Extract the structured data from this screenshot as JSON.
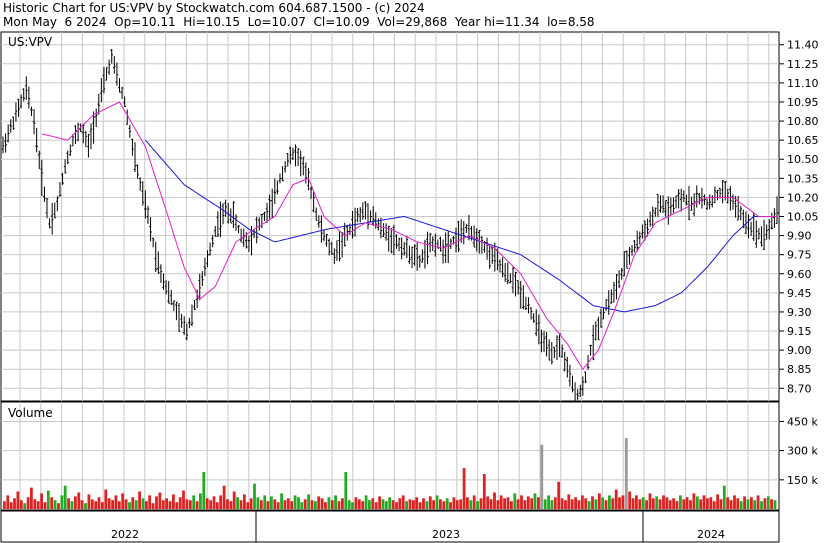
{
  "header": {
    "line1": "Historic Chart for US:VPV by Stockwatch.com 604.687.1500 - (c) 2024",
    "line2": "Mon May  6 2024  Op=10.11  Hi=10.15  Lo=10.07  Cl=10.09  Vol=29,868  Year hi=11.34  lo=8.58"
  },
  "chart_data": [
    {
      "type": "candlestick",
      "title": "US:VPV",
      "ylim": [
        8.6,
        11.5
      ],
      "yticks": [
        "11.40",
        "11.25",
        "11.10",
        "10.95",
        "10.80",
        "10.65",
        "10.50",
        "10.35",
        "10.20",
        "10.05",
        "9.90",
        "9.75",
        "9.60",
        "9.45",
        "9.30",
        "9.15",
        "9.00",
        "8.85",
        "8.70"
      ],
      "grid": true,
      "series": [
        {
          "key": "price",
          "points": [
            [
              0,
              10.6
            ],
            [
              5,
              10.85
            ],
            [
              9,
              11.05
            ],
            [
              12,
              10.8
            ],
            [
              15,
              10.35
            ],
            [
              18,
              10.0
            ],
            [
              21,
              10.15
            ],
            [
              24,
              10.45
            ],
            [
              27,
              10.65
            ],
            [
              30,
              10.75
            ],
            [
              33,
              10.6
            ],
            [
              36,
              10.85
            ],
            [
              39,
              11.1
            ],
            [
              42,
              11.3
            ],
            [
              44,
              11.15
            ],
            [
              47,
              10.95
            ],
            [
              50,
              10.6
            ],
            [
              53,
              10.3
            ],
            [
              56,
              10.05
            ],
            [
              59,
              9.75
            ],
            [
              62,
              9.55
            ],
            [
              65,
              9.4
            ],
            [
              68,
              9.25
            ],
            [
              71,
              9.15
            ],
            [
              74,
              9.35
            ],
            [
              77,
              9.55
            ],
            [
              80,
              9.8
            ],
            [
              83,
              10.0
            ],
            [
              86,
              10.1
            ],
            [
              89,
              10.05
            ],
            [
              92,
              9.9
            ],
            [
              95,
              9.85
            ],
            [
              98,
              9.95
            ],
            [
              101,
              10.05
            ],
            [
              104,
              10.15
            ],
            [
              107,
              10.35
            ],
            [
              110,
              10.5
            ],
            [
              113,
              10.55
            ],
            [
              116,
              10.45
            ],
            [
              119,
              10.25
            ],
            [
              122,
              10.0
            ],
            [
              125,
              9.85
            ],
            [
              128,
              9.75
            ],
            [
              131,
              9.85
            ],
            [
              134,
              9.95
            ],
            [
              137,
              10.05
            ],
            [
              140,
              10.1
            ],
            [
              143,
              10.05
            ],
            [
              146,
              9.95
            ],
            [
              149,
              9.9
            ],
            [
              152,
              9.85
            ],
            [
              155,
              9.8
            ],
            [
              158,
              9.75
            ],
            [
              161,
              9.7
            ],
            [
              164,
              9.8
            ],
            [
              167,
              9.85
            ],
            [
              170,
              9.8
            ],
            [
              173,
              9.85
            ],
            [
              176,
              9.9
            ],
            [
              179,
              9.95
            ],
            [
              182,
              9.9
            ],
            [
              185,
              9.85
            ],
            [
              188,
              9.75
            ],
            [
              191,
              9.7
            ],
            [
              194,
              9.6
            ],
            [
              197,
              9.55
            ],
            [
              200,
              9.45
            ],
            [
              203,
              9.35
            ],
            [
              206,
              9.2
            ],
            [
              209,
              9.05
            ],
            [
              212,
              8.95
            ],
            [
              215,
              9.05
            ],
            [
              218,
              8.85
            ],
            [
              221,
              8.65
            ],
            [
              224,
              8.7
            ],
            [
              227,
              9.0
            ],
            [
              230,
              9.2
            ],
            [
              233,
              9.35
            ],
            [
              236,
              9.45
            ],
            [
              239,
              9.6
            ],
            [
              242,
              9.75
            ],
            [
              245,
              9.85
            ],
            [
              248,
              9.95
            ],
            [
              251,
              10.05
            ],
            [
              254,
              10.15
            ],
            [
              257,
              10.1
            ],
            [
              260,
              10.15
            ],
            [
              263,
              10.2
            ],
            [
              266,
              10.15
            ],
            [
              269,
              10.2
            ],
            [
              272,
              10.15
            ],
            [
              275,
              10.2
            ],
            [
              278,
              10.25
            ],
            [
              281,
              10.2
            ],
            [
              284,
              10.1
            ],
            [
              287,
              10.0
            ],
            [
              290,
              9.95
            ],
            [
              293,
              9.9
            ],
            [
              296,
              9.95
            ],
            [
              299,
              10.1
            ]
          ]
        },
        {
          "key": "ma-short",
          "points": [
            [
              15,
              10.7
            ],
            [
              25,
              10.65
            ],
            [
              35,
              10.85
            ],
            [
              45,
              10.95
            ],
            [
              55,
              10.6
            ],
            [
              63,
              10.1
            ],
            [
              70,
              9.65
            ],
            [
              76,
              9.4
            ],
            [
              82,
              9.5
            ],
            [
              90,
              9.85
            ],
            [
              97,
              9.95
            ],
            [
              105,
              10.05
            ],
            [
              112,
              10.3
            ],
            [
              118,
              10.35
            ],
            [
              124,
              10.05
            ],
            [
              132,
              9.9
            ],
            [
              140,
              10.0
            ],
            [
              150,
              9.95
            ],
            [
              160,
              9.85
            ],
            [
              170,
              9.8
            ],
            [
              180,
              9.9
            ],
            [
              190,
              9.8
            ],
            [
              200,
              9.6
            ],
            [
              210,
              9.25
            ],
            [
              218,
              9.05
            ],
            [
              224,
              8.85
            ],
            [
              230,
              9.0
            ],
            [
              236,
              9.3
            ],
            [
              244,
              9.75
            ],
            [
              252,
              10.0
            ],
            [
              262,
              10.1
            ],
            [
              272,
              10.2
            ],
            [
              282,
              10.2
            ],
            [
              292,
              10.05
            ],
            [
              299,
              10.05
            ]
          ]
        },
        {
          "key": "ma-long",
          "points": [
            [
              55,
              10.65
            ],
            [
              70,
              10.3
            ],
            [
              85,
              10.1
            ],
            [
              95,
              9.95
            ],
            [
              105,
              9.85
            ],
            [
              115,
              9.9
            ],
            [
              125,
              9.95
            ],
            [
              140,
              10.0
            ],
            [
              155,
              10.05
            ],
            [
              170,
              9.95
            ],
            [
              185,
              9.85
            ],
            [
              200,
              9.75
            ],
            [
              215,
              9.55
            ],
            [
              228,
              9.35
            ],
            [
              240,
              9.3
            ],
            [
              252,
              9.35
            ],
            [
              262,
              9.45
            ],
            [
              272,
              9.65
            ],
            [
              282,
              9.9
            ],
            [
              290,
              10.05
            ],
            [
              299,
              10.05
            ]
          ]
        }
      ]
    },
    {
      "type": "bar",
      "title": "Volume",
      "ylim": [
        0,
        550
      ],
      "yticks": [
        "450 k",
        "300 k",
        "150 k"
      ],
      "values": [
        40,
        70,
        35,
        55,
        90,
        45,
        30,
        60,
        110,
        50,
        40,
        80,
        35,
        95,
        60,
        45,
        30,
        70,
        120,
        55,
        40,
        65,
        85,
        45,
        30,
        75,
        50,
        40,
        60,
        35,
        100,
        55,
        45,
        70,
        40,
        80,
        50,
        35,
        60,
        45,
        90,
        55,
        40,
        70,
        30,
        65,
        85,
        45,
        55,
        40,
        75,
        35,
        60,
        95,
        50,
        45,
        70,
        40,
        80,
        190,
        55,
        45,
        65,
        35,
        70,
        120,
        50,
        40,
        90,
        60,
        45,
        75,
        35,
        55,
        130,
        60,
        45,
        70,
        40,
        65,
        50,
        35,
        80,
        45,
        55,
        40,
        70,
        60,
        35,
        50,
        75,
        45,
        40,
        65,
        55,
        35,
        60,
        45,
        70,
        40,
        55,
        190,
        45,
        35,
        60,
        50,
        40,
        70,
        45,
        55,
        35,
        65,
        50,
        40,
        60,
        45,
        35,
        55,
        70,
        40,
        50,
        45,
        60,
        35,
        55,
        40,
        65,
        45,
        70,
        50,
        40,
        55,
        35,
        60,
        45,
        50,
        210,
        60,
        45,
        70,
        40,
        55,
        180,
        65,
        50,
        85,
        45,
        70,
        55,
        60,
        40,
        80,
        50,
        70,
        45,
        65,
        55,
        80,
        60,
        330,
        50,
        70,
        45,
        60,
        140,
        55,
        45,
        75,
        50,
        60,
        45,
        70,
        55,
        40,
        65,
        50,
        80,
        60,
        45,
        70,
        55,
        100,
        60,
        70,
        365,
        90,
        55,
        70,
        50,
        60,
        45,
        80,
        55,
        65,
        50,
        70,
        60,
        45,
        55,
        40,
        70,
        50,
        60,
        45,
        80,
        65,
        50,
        70,
        55,
        60,
        40,
        75,
        50,
        120,
        60,
        45,
        70,
        55,
        40,
        65,
        50,
        60,
        45,
        70,
        40,
        55,
        65,
        50,
        45
      ],
      "x_labels": [
        "2022",
        "2023",
        "2024"
      ]
    }
  ]
}
